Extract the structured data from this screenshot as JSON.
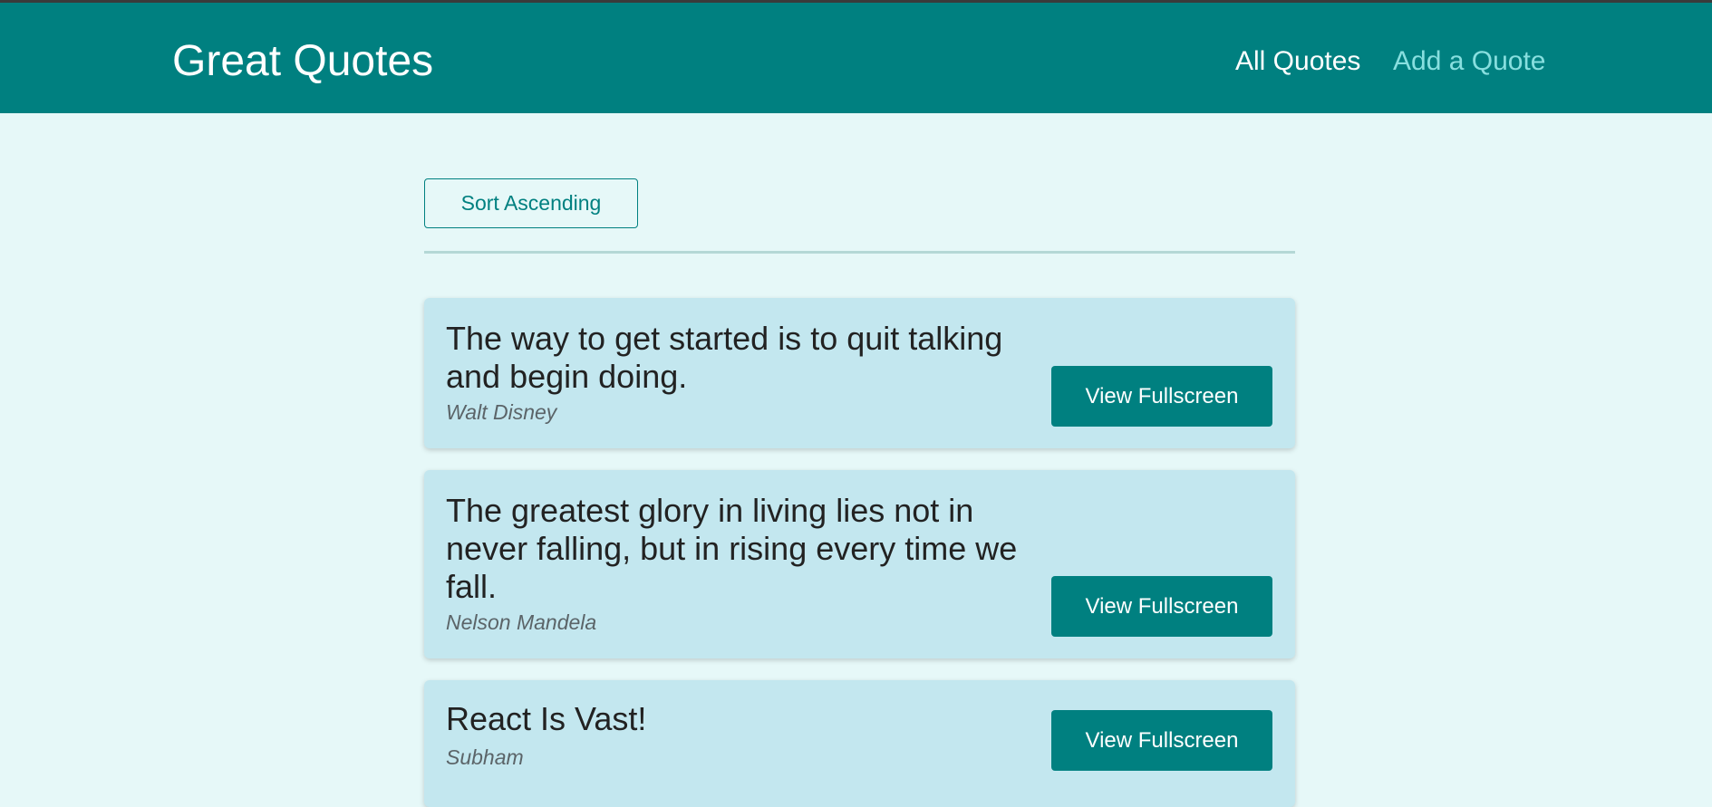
{
  "header": {
    "title": "Great Quotes",
    "nav": [
      {
        "label": "All Quotes"
      },
      {
        "label": "Add a Quote"
      }
    ]
  },
  "controls": {
    "sort_label": "Sort Ascending"
  },
  "quotes": [
    {
      "text": "The way to get started is to quit talking and begin doing.",
      "author": "Walt Disney",
      "button": "View Fullscreen"
    },
    {
      "text": "The greatest glory in living lies not in never falling, but in rising every time we fall.",
      "author": "Nelson Mandela",
      "button": "View Fullscreen"
    },
    {
      "text": "React Is Vast!",
      "author": "Subham",
      "button": "View Fullscreen"
    }
  ],
  "colors": {
    "header_bg": "#008080",
    "page_bg": "#e6f8f8",
    "card_bg": "#c3e7ef",
    "active_link": "#88dfdf"
  }
}
